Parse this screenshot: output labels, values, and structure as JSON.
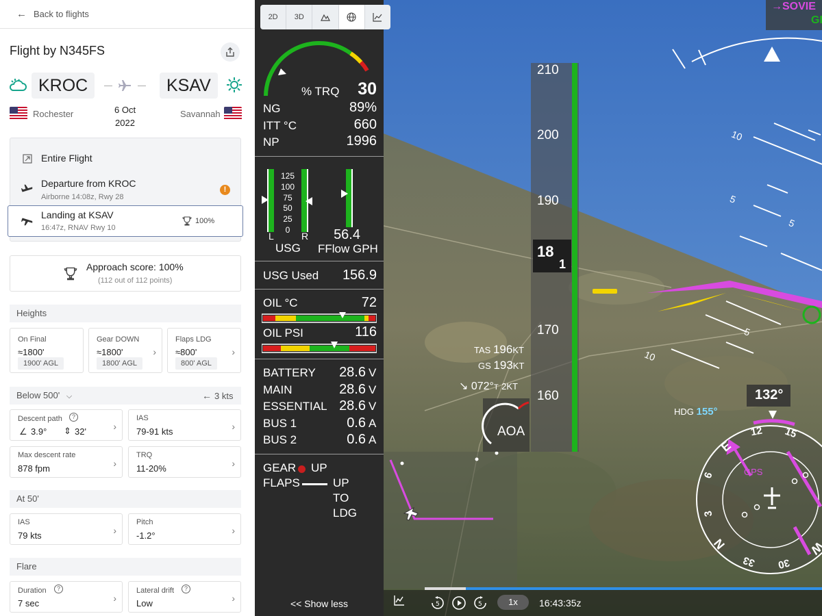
{
  "nav": {
    "back_label": "Back to flights"
  },
  "flight": {
    "title": "Flight by N345FS",
    "from": "KROC",
    "to": "KSAV",
    "from_city": "Rochester",
    "to_city": "Savannah",
    "date_line1": "6 Oct",
    "date_line2": "2022"
  },
  "phases": [
    {
      "label": "Entire Flight",
      "sub": ""
    },
    {
      "label": "Departure from KROC",
      "sub": "Airborne 14:08z, Rwy 28"
    },
    {
      "label": "Landing at KSAV",
      "sub": "16:47z, RNAV Rwy 10",
      "score": "100%"
    }
  ],
  "approach": {
    "title": "Approach score: 100%",
    "sub": "(112 out of 112 points)"
  },
  "heights": {
    "section": "Heights",
    "cards": [
      {
        "label": "On Final",
        "value": "≈1800'",
        "pill": "1900' AGL"
      },
      {
        "label": "Gear DOWN",
        "value": "≈1800'",
        "pill": "1800' AGL"
      },
      {
        "label": "Flaps LDG",
        "value": "≈800'",
        "pill": "800' AGL"
      }
    ]
  },
  "below500": {
    "section": "Below 500'",
    "wind": "3 kts",
    "descent_path": {
      "label": "Descent path",
      "angle": "3.9°",
      "offset": "32'"
    },
    "ias": {
      "label": "IAS",
      "value": "79-91 kts"
    },
    "max_descent": {
      "label": "Max descent rate",
      "value": "878 fpm"
    },
    "trq": {
      "label": "TRQ",
      "value": "11-20%"
    }
  },
  "at50": {
    "section": "At 50'",
    "ias": {
      "label": "IAS",
      "value": "79 kts"
    },
    "pitch": {
      "label": "Pitch",
      "value": "-1.2°"
    }
  },
  "flare": {
    "section": "Flare",
    "duration": {
      "label": "Duration",
      "value": "7 sec"
    },
    "drift": {
      "label": "Lateral drift",
      "value": "Low"
    }
  },
  "toolbar": {
    "b2d": "2D",
    "b3d": "3D"
  },
  "engine": {
    "trq_label": "% TRQ",
    "trq": "30",
    "trq_fraction": 0.3,
    "ng_label": "NG",
    "ng": "89%",
    "itt_label": "ITT °C",
    "itt": "660",
    "np_label": "NP",
    "np": "1996"
  },
  "fuel": {
    "scale": [
      "125",
      "100",
      "75",
      "50",
      "25",
      "0"
    ],
    "left": "L",
    "right": "R",
    "usg": "USG",
    "fflow": "56.4",
    "fflow_label": "FFlow GPH",
    "used_label": "USG Used",
    "used": "156.9"
  },
  "oil": {
    "temp_label": "OIL °C",
    "temp": "72",
    "psi_label": "OIL PSI",
    "psi": "116"
  },
  "elec": [
    {
      "label": "BATTERY",
      "value": "28.6",
      "unit": "V"
    },
    {
      "label": "MAIN",
      "value": "28.6",
      "unit": "V"
    },
    {
      "label": "ESSENTIAL",
      "value": "28.6",
      "unit": "V"
    },
    {
      "label": "BUS 1",
      "value": "0.6",
      "unit": "A"
    },
    {
      "label": "BUS 2",
      "value": "0.6",
      "unit": "A"
    }
  ],
  "gear": {
    "gear_label": "GEAR",
    "gear_state": "UP",
    "flaps_label": "FLAPS",
    "flaps_1": "UP",
    "flaps_2": "TO",
    "flaps_3": "LDG"
  },
  "show_less": "<< Show less",
  "sv": {
    "speeds": [
      "210",
      "200",
      "190",
      "170",
      "160"
    ],
    "current_speed_top": "18",
    "current_speed_bot": "1",
    "tas_label": "TAS",
    "tas": "196",
    "gs_label": "GS",
    "gs": "193",
    "kt": "KT",
    "wind": "072°",
    "wind_t": "T",
    "wind_kt": "2KT",
    "aoa": "AOA",
    "heading": "132°",
    "hdg_label": "HDG",
    "hdg": "155°",
    "gps": "GPS",
    "top_label_1": "→SOVIE",
    "top_label_2": "GI",
    "pitch_10": "10",
    "pitch_5": "5",
    "compass": [
      "12",
      "15",
      "E",
      "6",
      "3",
      "N",
      "33",
      "30",
      "W"
    ],
    "speed": "1x",
    "time": "16:43:35z"
  },
  "colors": {
    "green": "#1db31d",
    "magenta": "#d84be0",
    "yellow": "#f3d400",
    "blue": "#2f8fe6"
  }
}
